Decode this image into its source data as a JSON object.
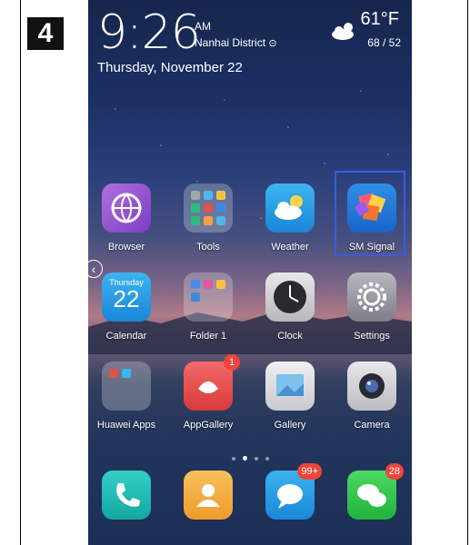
{
  "step_number": "4",
  "status": {
    "time": "9:26",
    "ampm": "AM",
    "location": "Nanhai District",
    "date": "Thursday, November 22",
    "temperature": "61°F",
    "temp_range": "68 / 52"
  },
  "apps_row1": [
    {
      "label": "Browser"
    },
    {
      "label": "Tools"
    },
    {
      "label": "Weather"
    },
    {
      "label": "SM Signal"
    }
  ],
  "apps_row2": [
    {
      "label": "Calendar",
      "day": "Thursday",
      "date": "22"
    },
    {
      "label": "Folder 1"
    },
    {
      "label": "Clock"
    },
    {
      "label": "Settings"
    }
  ],
  "apps_row3": [
    {
      "label": "Huawei Apps"
    },
    {
      "label": "AppGallery",
      "badge": "1"
    },
    {
      "label": "Gallery"
    },
    {
      "label": "Camera"
    }
  ],
  "dock": [
    {
      "name": "phone",
      "badge": ""
    },
    {
      "name": "contacts",
      "badge": ""
    },
    {
      "name": "messages",
      "badge": "99+"
    },
    {
      "name": "wechat",
      "badge": "28"
    }
  ],
  "colors": {
    "highlight": "#3b5bdb",
    "badge": "#f0453a"
  }
}
